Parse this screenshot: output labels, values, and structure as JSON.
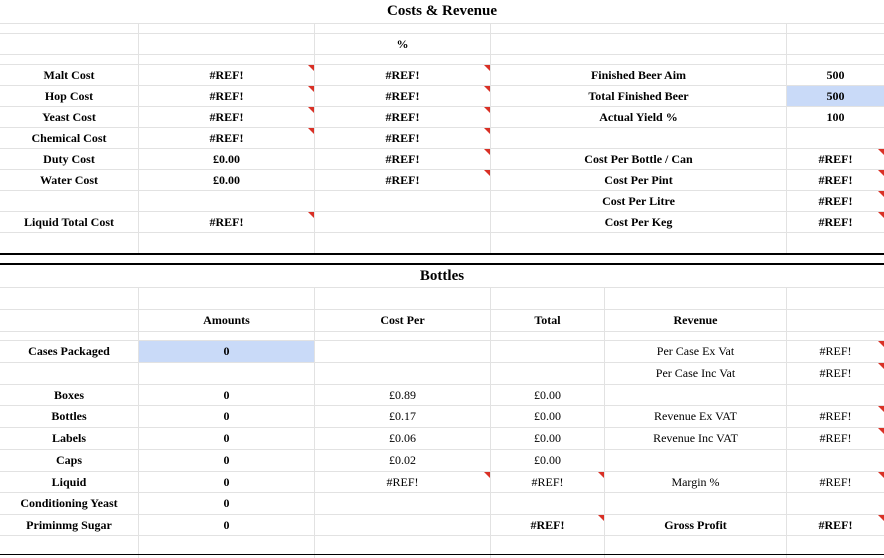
{
  "costs": {
    "title": "Costs & Revenue",
    "pct_header": "%",
    "rows": [
      {
        "label": "Malt Cost",
        "value": "#REF!",
        "pct": "#REF!"
      },
      {
        "label": "Hop Cost",
        "value": "#REF!",
        "pct": "#REF!"
      },
      {
        "label": "Yeast Cost",
        "value": "#REF!",
        "pct": "#REF!"
      },
      {
        "label": "Chemical Cost",
        "value": "#REF!",
        "pct": "#REF!"
      },
      {
        "label": "Duty Cost",
        "value": "£0.00",
        "pct": "#REF!"
      },
      {
        "label": "Water Cost",
        "value": "£0.00",
        "pct": "#REF!"
      }
    ],
    "liquid_total": {
      "label": "Liquid Total Cost",
      "value": "#REF!"
    },
    "right": [
      {
        "label": "Finished Beer Aim",
        "value": "500"
      },
      {
        "label": "Total Finished Beer",
        "value": "500"
      },
      {
        "label": "Actual Yield %",
        "value": "100"
      },
      {
        "label": "Cost Per Bottle / Can",
        "value": "#REF!"
      },
      {
        "label": "Cost Per Pint",
        "value": "#REF!"
      },
      {
        "label": "Cost Per Litre",
        "value": "#REF!"
      },
      {
        "label": "Cost Per Keg",
        "value": "#REF!"
      }
    ]
  },
  "bottles": {
    "title": "Bottles",
    "headers": {
      "amounts": "Amounts",
      "cost_per": "Cost Per",
      "total": "Total",
      "revenue": "Revenue"
    },
    "cases": {
      "label": "Cases Packaged",
      "amount": "0"
    },
    "rows": [
      {
        "label": "Boxes",
        "amount": "0",
        "cost_per": "£0.89",
        "total": "£0.00"
      },
      {
        "label": "Bottles",
        "amount": "0",
        "cost_per": "£0.17",
        "total": "£0.00"
      },
      {
        "label": "Labels",
        "amount": "0",
        "cost_per": "£0.06",
        "total": "£0.00"
      },
      {
        "label": "Caps",
        "amount": "0",
        "cost_per": "£0.02",
        "total": "£0.00"
      },
      {
        "label": "Liquid",
        "amount": "0",
        "cost_per": "#REF!",
        "total": "#REF!"
      },
      {
        "label": "Conditioning Yeast",
        "amount": "0",
        "cost_per": "",
        "total": ""
      },
      {
        "label": "Priminmg Sugar",
        "amount": "0",
        "cost_per": "",
        "total": "#REF!"
      }
    ],
    "revenue": [
      {
        "label": "Per Case Ex Vat",
        "value": "#REF!"
      },
      {
        "label": "Per Case Inc Vat",
        "value": "#REF!"
      },
      {
        "label": "Revenue Ex VAT",
        "value": "#REF!"
      },
      {
        "label": "Revenue Inc VAT",
        "value": "#REF!"
      },
      {
        "label": "Margin %",
        "value": "#REF!"
      },
      {
        "label": "Gross Profit",
        "value": "#REF!"
      }
    ]
  }
}
